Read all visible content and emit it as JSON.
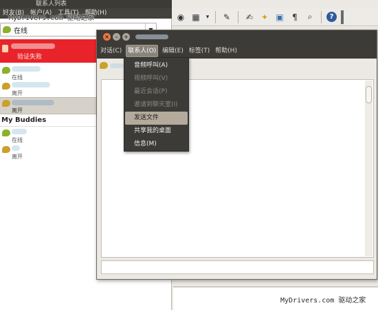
{
  "buddy_list": {
    "title": "联系人列表",
    "menu": [
      "好友(B)",
      "帐户(A)",
      "工具(T)",
      "帮助(H)"
    ],
    "status": "在线",
    "error_contact_status": "验证失败",
    "contacts": [
      {
        "status": "在线",
        "kind": "online"
      },
      {
        "status": "离开",
        "kind": "away"
      }
    ],
    "selected_contact_status": "离开",
    "group_name": "My Buddies",
    "group_contacts": [
      {
        "status": "在线",
        "kind": "online"
      },
      {
        "status": "离开",
        "kind": "away"
      }
    ]
  },
  "chat_window": {
    "menu": [
      {
        "label": "对话(C)",
        "active": false
      },
      {
        "label": "联系人(O)",
        "active": true
      },
      {
        "label": "编辑(E)",
        "active": false
      },
      {
        "label": "标签(T)",
        "active": false
      },
      {
        "label": "帮助(H)",
        "active": false
      }
    ],
    "contact_menu": [
      {
        "label": "音频呼叫(A)",
        "state": "enabled"
      },
      {
        "label": "视频呼叫(V)",
        "state": "disabled"
      },
      {
        "label": "最近会话(P)",
        "state": "disabled"
      },
      {
        "label": "邀请到聊天室(I)",
        "state": "disabled"
      },
      {
        "label": "发送文件",
        "state": "hover"
      },
      {
        "label": "共享我的桌面",
        "state": "enabled"
      },
      {
        "label": "信息(M)",
        "state": "enabled"
      }
    ]
  },
  "editor_toolbar": {
    "icons": [
      "globe-icon",
      "table-icon",
      "dropdown-icon",
      "edit-pencil-icon",
      "note-edit-icon",
      "navigator-icon",
      "gallery-icon",
      "pilcrow-icon",
      "zoom-icon",
      "help-icon"
    ],
    "glyphs": {
      "globe-icon": "◉",
      "table-icon": "▦",
      "dropdown-icon": "▾",
      "edit-pencil-icon": "✎",
      "note-edit-icon": "✍",
      "navigator-icon": "✦",
      "gallery-icon": "▣",
      "pilcrow-icon": "¶",
      "zoom-icon": "⌕",
      "help-icon": "?"
    }
  },
  "watermark": {
    "top": "MyDrivers.com 驱动之家",
    "bottom": "MyDrivers.com 驱动之家"
  },
  "colors": {
    "error_row": "#e8242a",
    "chat_online": "#8bb12a",
    "chat_away": "#caa12b",
    "close_button": "#f07746",
    "menu_highlight": "#b4ab9d"
  }
}
